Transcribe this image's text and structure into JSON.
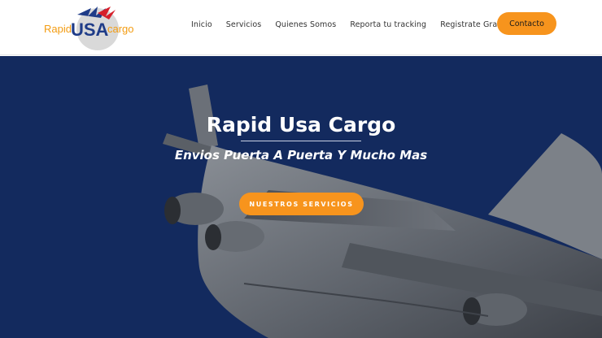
{
  "header": {
    "logo": {
      "left_text": "Rapid",
      "mid_text": "USA",
      "right_text": "cargo"
    },
    "nav": [
      {
        "label": "Inicio",
        "name": "nav-inicio"
      },
      {
        "label": "Servicios",
        "name": "nav-servicios"
      },
      {
        "label": "Quienes Somos",
        "name": "nav-quienes-somos"
      },
      {
        "label": "Reporta tu tracking",
        "name": "nav-reporta-tracking"
      },
      {
        "label": "Registrate Gratis",
        "name": "nav-registrate"
      }
    ],
    "contact_label": "Contacto"
  },
  "hero": {
    "title": "Rapid Usa Cargo",
    "subtitle": "Envios Puerta A Puerta Y Mucho Mas",
    "button_label": "NUESTROS SERVICIOS"
  },
  "colors": {
    "accent": "#f7941d",
    "hero_background": "#132a5e",
    "logo_orange": "#f39c12",
    "logo_blue": "#1f3c88",
    "logo_red": "#d6202b"
  }
}
